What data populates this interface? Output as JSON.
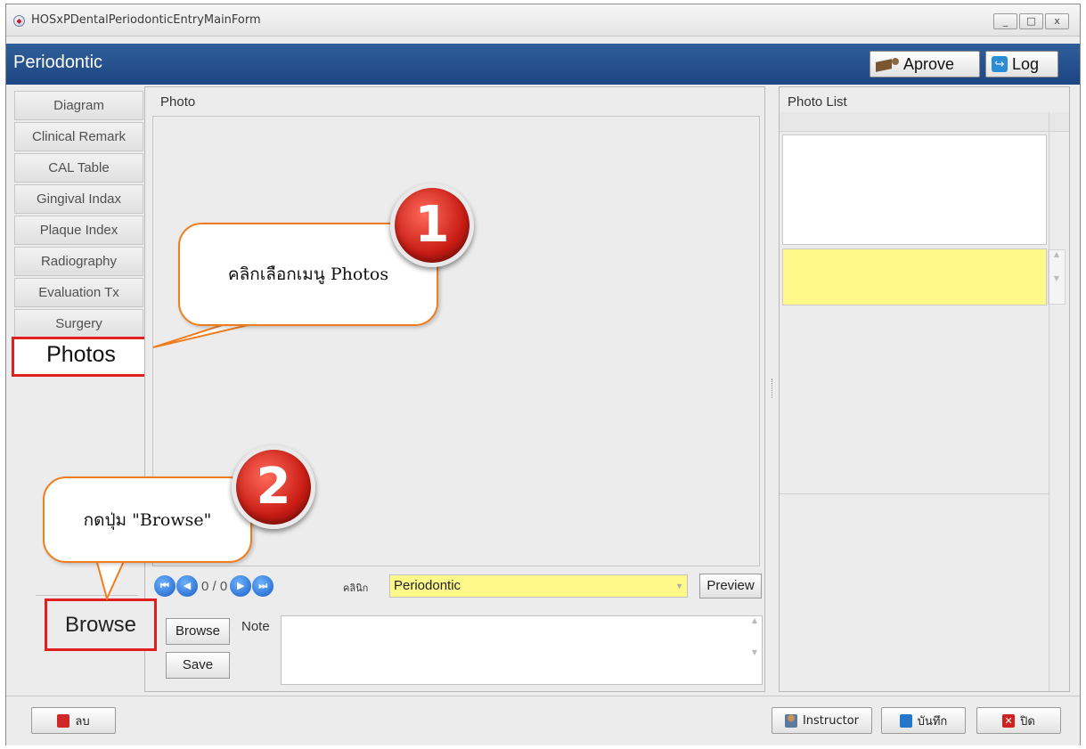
{
  "window": {
    "title": "HOSxPDentalPeriodonticEntryMainForm",
    "minimize": "_",
    "maximize": "□",
    "close": "x"
  },
  "header": {
    "title": "Periodontic",
    "aprove_label": "Aprove",
    "log_label": "Log"
  },
  "tabs": [
    {
      "label": "Diagram"
    },
    {
      "label": "Clinical Remark"
    },
    {
      "label": "CAL Table"
    },
    {
      "label": "Gingival Indax"
    },
    {
      "label": "Plaque Index"
    },
    {
      "label": "Radiography"
    },
    {
      "label": "Evaluation Tx"
    },
    {
      "label": "Surgery"
    },
    {
      "label": "Photos",
      "active": true
    }
  ],
  "photo_panel": {
    "title": "Photo",
    "counter": "0 / 0",
    "clinic_label": "คลินิก",
    "clinic_value": "Periodontic",
    "preview_label": "Preview",
    "browse_label": "Browse",
    "save_label": "Save",
    "note_label": "Note",
    "note_value": ""
  },
  "photo_list": {
    "title": "Photo List"
  },
  "footer": {
    "delete_label": "ลบ",
    "instructor_label": "Instructor",
    "save_label": "บันทึก",
    "close_label": "ปิด"
  },
  "annotations": {
    "callout1": "คลิกเลือกเมนู Photos",
    "callout2": "กดปุ่ม \"Browse\"",
    "badge1": "1",
    "badge2": "2",
    "highlight_browse": "Browse"
  },
  "colors": {
    "header_blue": "#1d4581",
    "highlight_red": "#e02020",
    "callout_orange": "#f07d1e",
    "field_yellow": "#fff98a"
  }
}
